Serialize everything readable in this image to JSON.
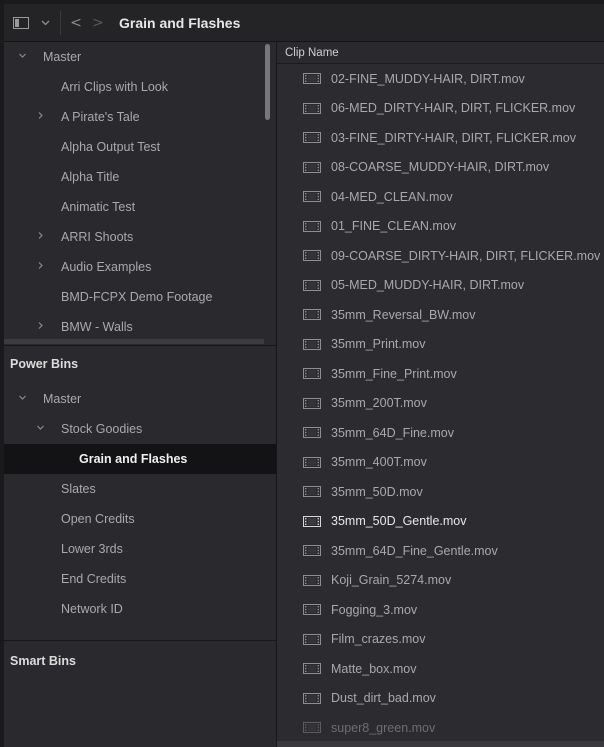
{
  "toolbar": {
    "title": "Grain and Flashes",
    "back_label": "<",
    "forward_label": ">"
  },
  "bin_tree": [
    {
      "label": "Master",
      "chevron": "down",
      "level": 0
    },
    {
      "label": "Arri Clips with Look",
      "chevron": "",
      "level": 1
    },
    {
      "label": "A Pirate's Tale",
      "chevron": "right",
      "level": 1
    },
    {
      "label": "Alpha Output Test",
      "chevron": "",
      "level": 1
    },
    {
      "label": "Alpha Title",
      "chevron": "",
      "level": 1
    },
    {
      "label": "Animatic Test",
      "chevron": "",
      "level": 1
    },
    {
      "label": "ARRI Shoots",
      "chevron": "right",
      "level": 1
    },
    {
      "label": "Audio Examples",
      "chevron": "right",
      "level": 1
    },
    {
      "label": "BMD-FCPX Demo Footage",
      "chevron": "",
      "level": 1
    },
    {
      "label": "BMW - Walls",
      "chevron": "right",
      "level": 1
    }
  ],
  "power_bins": {
    "header": "Power Bins",
    "items": [
      {
        "label": "Master",
        "chevron": "down",
        "level": 0
      },
      {
        "label": "Stock Goodies",
        "chevron": "down",
        "level": 1
      },
      {
        "label": "Grain and Flashes",
        "chevron": "",
        "level": 2,
        "selected": true
      },
      {
        "label": "Slates",
        "chevron": "",
        "level": 1
      },
      {
        "label": "Open Credits",
        "chevron": "",
        "level": 1
      },
      {
        "label": "Lower 3rds",
        "chevron": "",
        "level": 1
      },
      {
        "label": "End Credits",
        "chevron": "",
        "level": 1
      },
      {
        "label": "Network ID",
        "chevron": "",
        "level": 1
      }
    ]
  },
  "smart_bins": {
    "header": "Smart Bins"
  },
  "clip_list": {
    "column_header": "Clip Name",
    "clips": [
      {
        "name": "02-FINE_MUDDY-HAIR, DIRT.mov"
      },
      {
        "name": "06-MED_DIRTY-HAIR, DIRT, FLICKER.mov"
      },
      {
        "name": "03-FINE_DIRTY-HAIR, DIRT, FLICKER.mov"
      },
      {
        "name": "08-COARSE_MUDDY-HAIR, DIRT.mov"
      },
      {
        "name": "04-MED_CLEAN.mov"
      },
      {
        "name": "01_FINE_CLEAN.mov"
      },
      {
        "name": "09-COARSE_DIRTY-HAIR, DIRT, FLICKER.mov"
      },
      {
        "name": "05-MED_MUDDY-HAIR, DIRT.mov"
      },
      {
        "name": "35mm_Reversal_BW.mov"
      },
      {
        "name": "35mm_Print.mov"
      },
      {
        "name": "35mm_Fine_Print.mov"
      },
      {
        "name": "35mm_200T.mov"
      },
      {
        "name": "35mm_64D_Fine.mov"
      },
      {
        "name": "35mm_400T.mov"
      },
      {
        "name": "35mm_50D.mov"
      },
      {
        "name": "35mm_50D_Gentle.mov",
        "active": true
      },
      {
        "name": "35mm_64D_Fine_Gentle.mov"
      },
      {
        "name": "Koji_Grain_5274.mov"
      },
      {
        "name": "Fogging_3.mov"
      },
      {
        "name": "Film_crazes.mov"
      },
      {
        "name": "Matte_box.mov"
      },
      {
        "name": "Dust_dirt_bad.mov"
      },
      {
        "name": "super8_green.mov",
        "faded": true
      }
    ]
  }
}
